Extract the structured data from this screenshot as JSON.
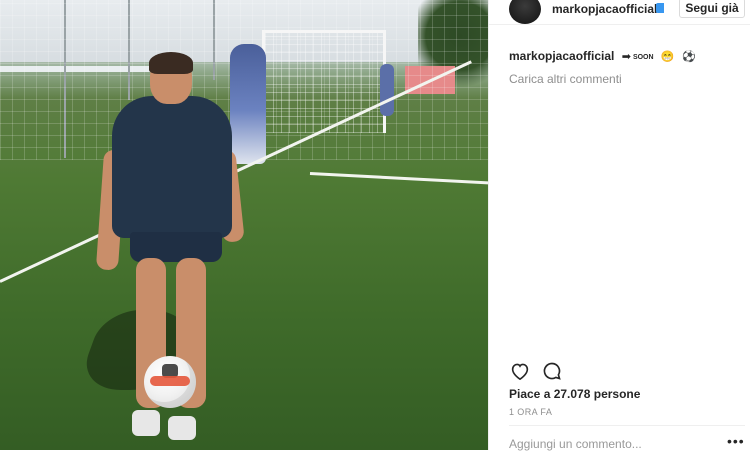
{
  "post": {
    "username": "markopjacaofficial",
    "follow_button_label": "Segui già",
    "caption": {
      "username": "markopjacaofficial",
      "soon_text": "SOON",
      "emojis": [
        "😁",
        "⚽"
      ]
    },
    "load_more_comments": "Carica altri commenti",
    "likes_text": "Piace a 27.078 persone",
    "time_ago": "1 ORA FA",
    "add_comment_placeholder": "Aggiungi un commento...",
    "more_options_glyph": "•••"
  },
  "photo": {
    "description_icon": "football-training-photo"
  },
  "icons": {
    "heart": "heart-icon",
    "comment": "comment-icon",
    "verified": "verified-badge-icon"
  },
  "colors": {
    "text": "#262626",
    "secondary_text": "#8e8e8e",
    "border": "#dbdbdb",
    "verified": "#3897f0"
  }
}
